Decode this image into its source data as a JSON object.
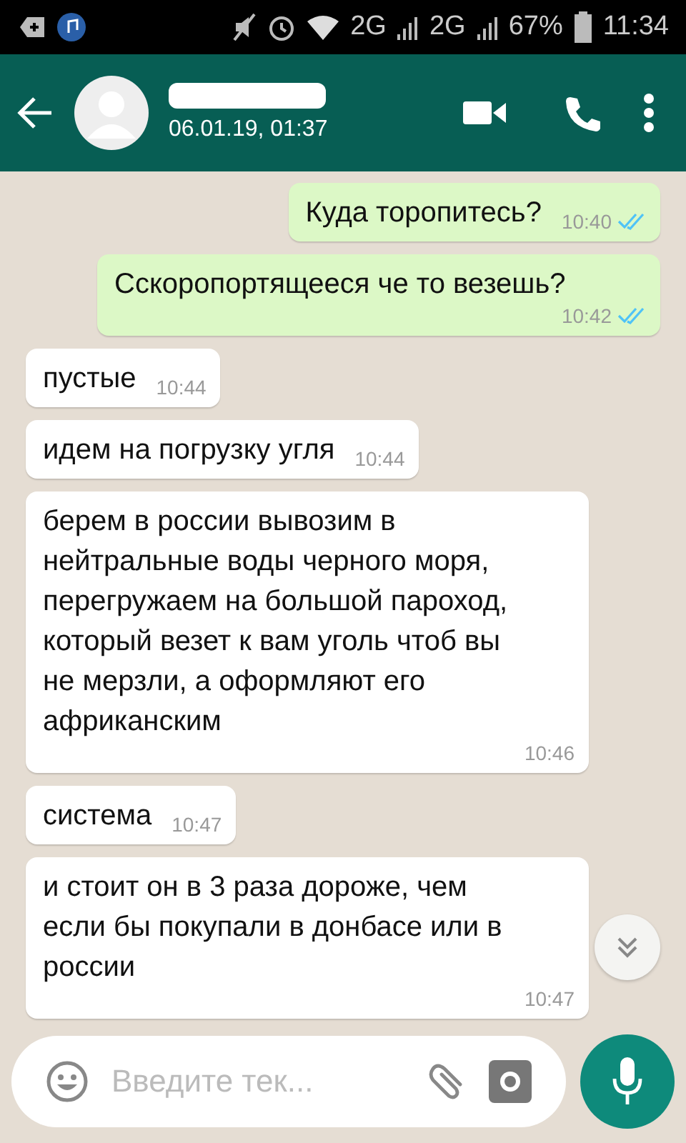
{
  "status_bar": {
    "network_1": "2G",
    "network_2": "2G",
    "battery": "67%",
    "time": "11:34"
  },
  "header": {
    "last_seen": "06.01.19, 01:37"
  },
  "messages": [
    {
      "kind": "outgoing",
      "text": "Куда торопитесь?",
      "time": "10:40",
      "read": true
    },
    {
      "kind": "outgoing",
      "text": "Сскоропортящееся че то везешь?",
      "time": "10:42",
      "read": true
    },
    {
      "kind": "incoming",
      "text": "пустые",
      "time": "10:44"
    },
    {
      "kind": "incoming",
      "text": "идем на погрузку угля",
      "time": "10:44"
    },
    {
      "kind": "incoming",
      "text": "берем в россии вывозим в нейтральные воды черного моря, перегружаем на большой пароход, который везет к вам уголь чтоб вы не мерзли, а оформляют его африканским",
      "time": "10:46"
    },
    {
      "kind": "incoming",
      "text": "система",
      "time": "10:47"
    },
    {
      "kind": "incoming",
      "text": "и стоит он в 3 раза дороже, чем если бы покупали в донбасе или в россии",
      "time": "10:47"
    }
  ],
  "composer": {
    "placeholder": "Введите тек..."
  }
}
